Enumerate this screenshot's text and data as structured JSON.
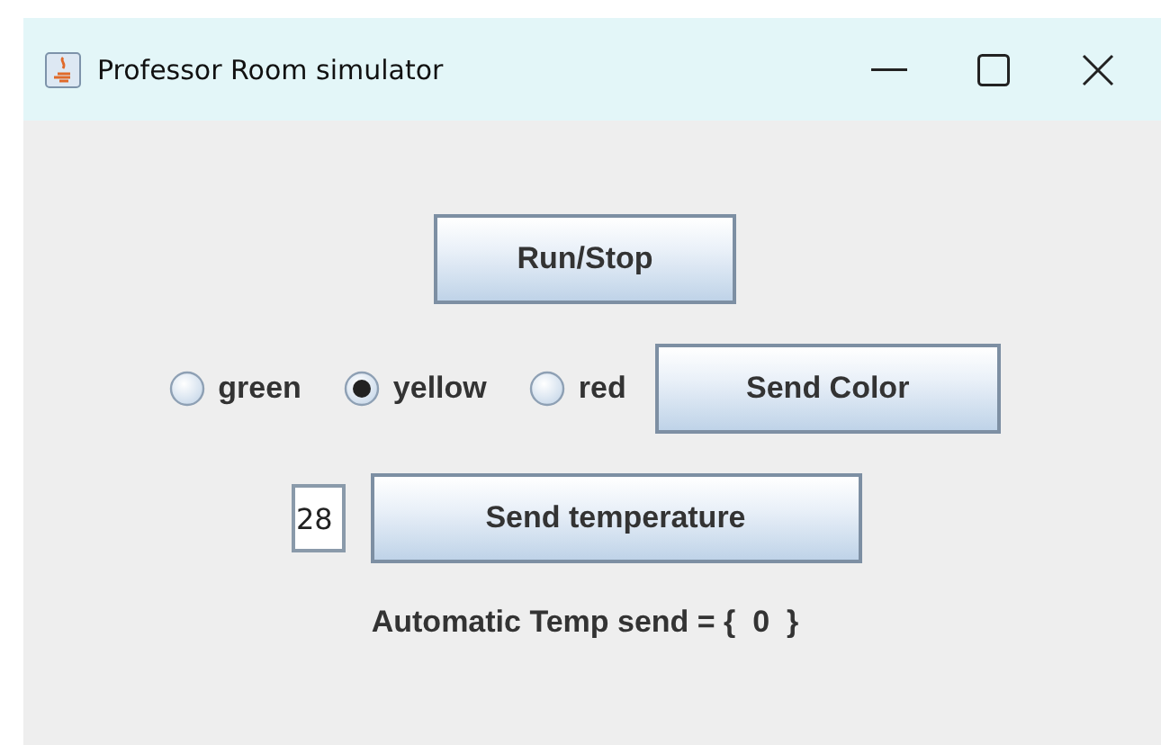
{
  "window": {
    "title": "Professor Room simulator"
  },
  "run_button": {
    "label": "Run/Stop"
  },
  "colors": [
    {
      "label": "green",
      "selected": false
    },
    {
      "label": "yellow",
      "selected": true
    },
    {
      "label": "red",
      "selected": false
    }
  ],
  "send_color_button": {
    "label": "Send Color"
  },
  "temperature_field": {
    "value": "28"
  },
  "send_temperature_button": {
    "label": "Send temperature"
  },
  "status": "Automatic Temp send = {  0  }"
}
